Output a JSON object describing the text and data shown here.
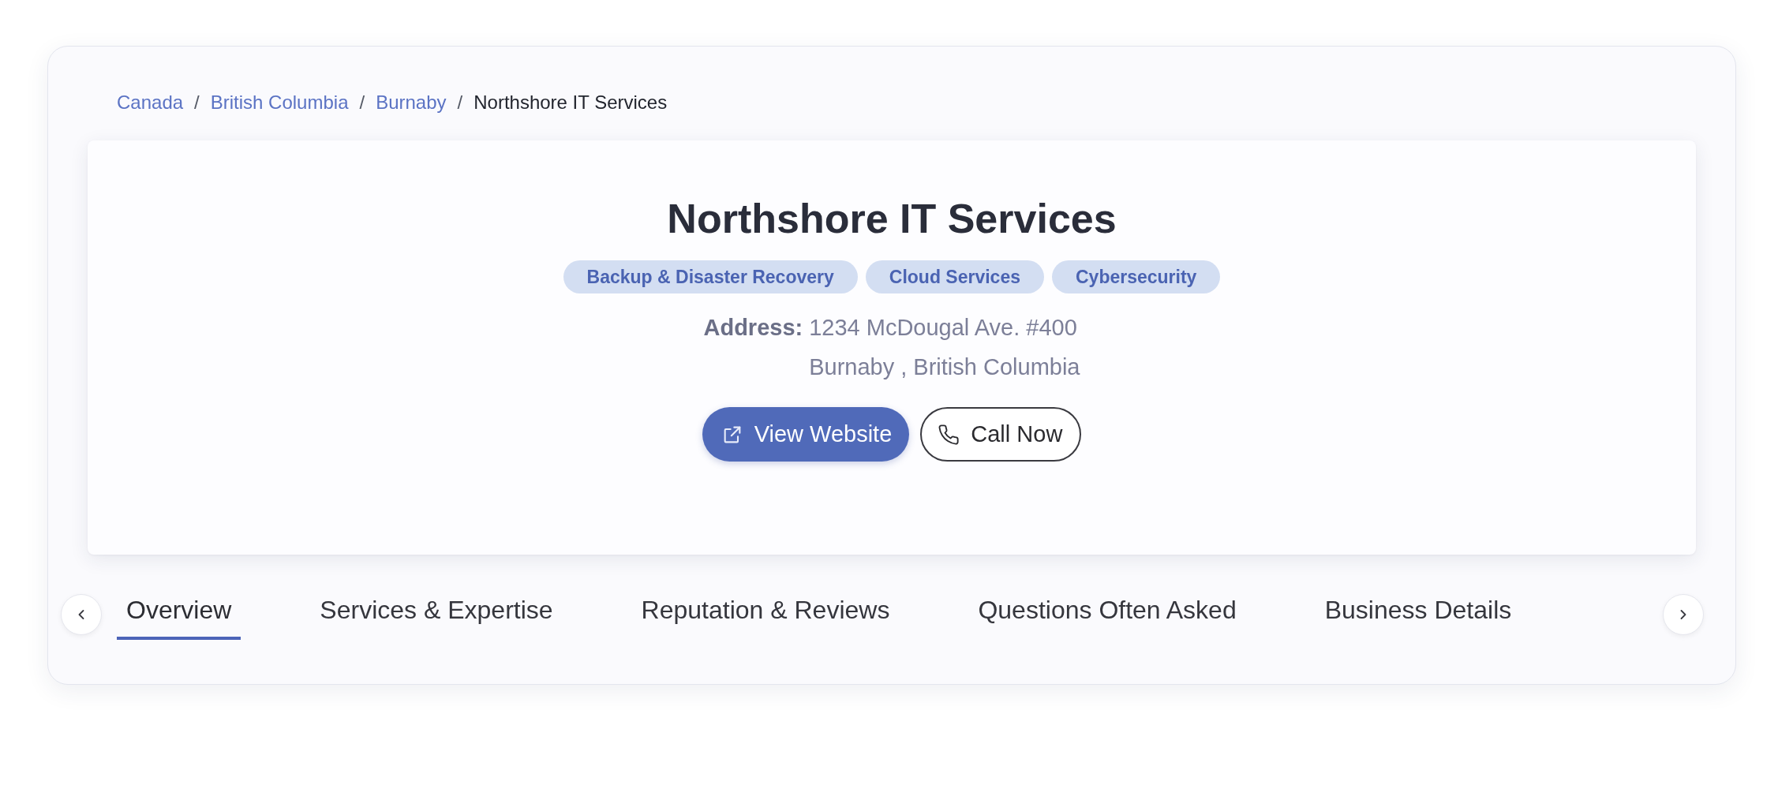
{
  "breadcrumb": [
    {
      "label": "Canada",
      "kind": "link"
    },
    {
      "separator": "/",
      "label": "British Columbia",
      "kind": "link"
    },
    {
      "separator": "/",
      "label": "Burnaby",
      "kind": "link"
    },
    {
      "separator": "/",
      "label": "Northshore IT Services",
      "kind": "current"
    }
  ],
  "business": {
    "name": "Northshore IT Services",
    "tags": [
      "Backup & Disaster Recovery",
      "Cloud Services",
      "Cybersecurity"
    ],
    "address": {
      "label": "Address:",
      "lines": [
        "1234 McDougal Ave. #400",
        "Burnaby , British Columbia"
      ]
    },
    "actions": [
      {
        "label": "View Website",
        "kind": "primary"
      },
      {
        "label": "Call Now",
        "kind": "outline"
      }
    ]
  },
  "tabs": [
    {
      "label": "Overview",
      "selected": true
    },
    {
      "label": "Services & Expertise",
      "selected": false
    },
    {
      "label": "Reputation & Reviews",
      "selected": false
    },
    {
      "label": "Questions Often Asked",
      "selected": false
    },
    {
      "label": "Business Details",
      "selected": false
    }
  ]
}
